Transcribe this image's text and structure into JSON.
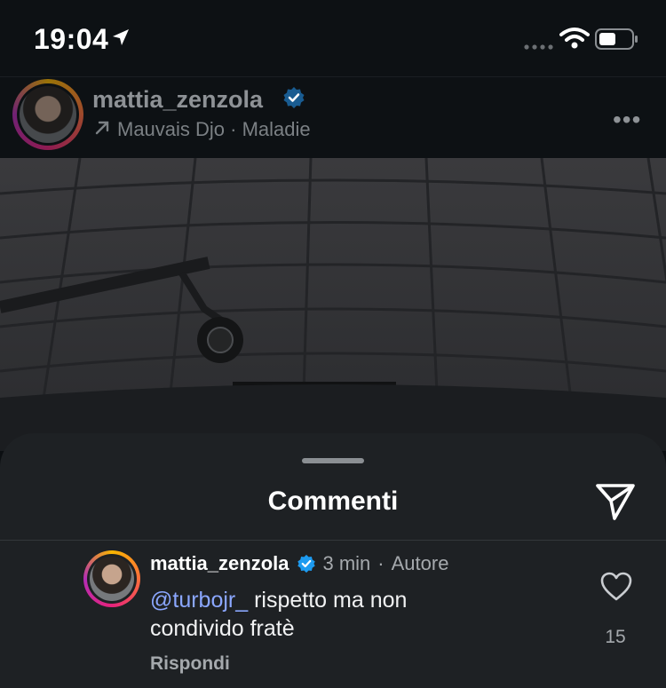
{
  "status_bar": {
    "time": "19:04"
  },
  "post": {
    "username": "mattia_zenzola",
    "audio_artist": "Mauvais Djo",
    "audio_separator": " · ",
    "audio_title": "Maladie",
    "more_label": "•••"
  },
  "comments_sheet": {
    "title": "Commenti",
    "comments": [
      {
        "username": "mattia_zenzola",
        "time": "3 min",
        "separator": "·",
        "author_tag": "Autore",
        "mention": "@turbojr_",
        "text": " rispetto ma non condivido fratè",
        "reply_label": "Rispondi",
        "likes": "15"
      }
    ]
  },
  "icons": {
    "location": "location-arrow-icon",
    "signal": "cellular-signal-icon",
    "wifi": "wifi-icon",
    "battery": "battery-icon",
    "verified": "verified-badge-icon",
    "music": "arrow-up-right-icon",
    "more": "more-horizontal-icon",
    "send": "send-icon",
    "heart": "heart-icon"
  },
  "colors": {
    "background": "#0c0f12",
    "sheet": "#1e2124",
    "verified": "#1d9bf0",
    "mention": "#8ba7ff"
  }
}
